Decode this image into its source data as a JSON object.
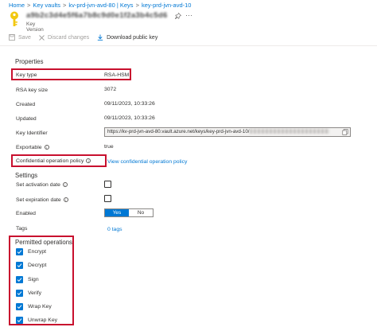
{
  "breadcrumb": [
    "Home",
    "Key vaults",
    "kv-prd-jvn-avd-80 | Keys",
    "key-prd-jvn-avd-10"
  ],
  "header": {
    "title": "a9b2c3d4e5f6a7b8c9d0e1f2a3b4c5d6",
    "subtitle": "Key Version",
    "pin_icon": "pin-icon",
    "more_label": "···"
  },
  "toolbar": {
    "save_label": "Save",
    "discard_label": "Discard changes",
    "download_label": "Download public key"
  },
  "properties": {
    "heading": "Properties",
    "key_type_label": "Key type",
    "key_type_value": "RSA-HSM",
    "key_size_label": "RSA key size",
    "key_size_value": "3072",
    "created_label": "Created",
    "created_value": "09/11/2023, 10:33:26",
    "updated_label": "Updated",
    "updated_value": "09/11/2023, 10:33:26",
    "key_identifier_label": "Key Identifier",
    "key_identifier_value": "https://kv-prd-jvn-avd-80.vault.azure.net/keys/key-prd-jvn-avd-10/",
    "exportable_label": "Exportable",
    "exportable_value": "true",
    "conf_policy_label": "Confidential operation policy",
    "conf_policy_link": "View confidential operation policy"
  },
  "settings": {
    "heading": "Settings",
    "activation_label": "Set activation date",
    "expiration_label": "Set expiration date",
    "enabled_label": "Enabled",
    "enabled_yes": "Yes",
    "enabled_no": "No",
    "enabled_value": true,
    "tags_label": "Tags",
    "tags_value": "0 tags"
  },
  "permitted": {
    "heading": "Permitted operations",
    "items": [
      "Encrypt",
      "Decrypt",
      "Sign",
      "Verify",
      "Wrap Key",
      "Unwrap Key"
    ]
  },
  "colors": {
    "accent": "#0078d4",
    "highlight_box": "#c8102e",
    "key_icon": "#f2c811"
  }
}
